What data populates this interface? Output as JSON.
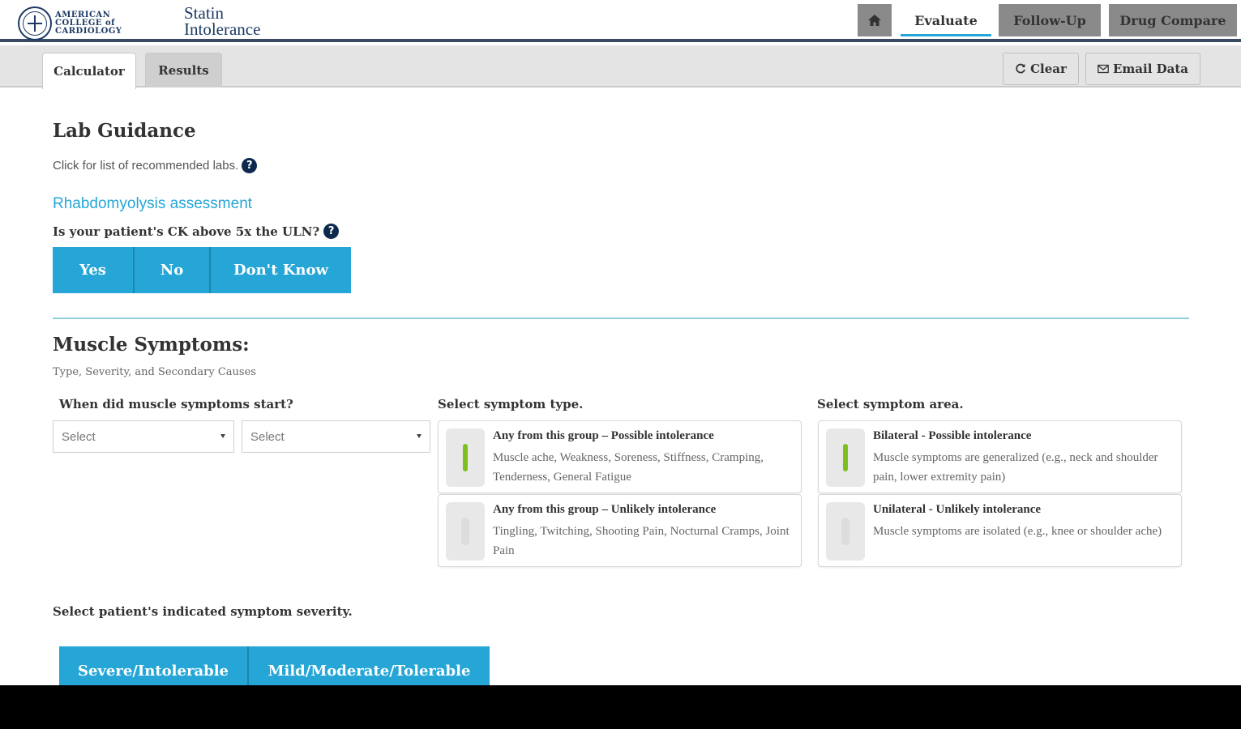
{
  "header": {
    "logo_text": [
      "AMERICAN",
      "COLLEGE of",
      "CARDIOLOGY"
    ],
    "app_title_line1": "Statin",
    "app_title_line2": "Intolerance",
    "nav": {
      "home_icon": "home-icon",
      "evaluate": "Evaluate",
      "follow_up": "Follow-Up",
      "drug_compare": "Drug Compare"
    }
  },
  "tabs": {
    "calculator": "Calculator",
    "results": "Results",
    "clear": "Clear",
    "clear_icon": "refresh-icon",
    "email": "Email Data",
    "email_icon": "envelope-icon"
  },
  "lab": {
    "title": "Lab Guidance",
    "subtitle": "Click for list of recommended labs.",
    "help_icon": "question-circle-icon"
  },
  "rhabdo": {
    "title": "Rhabdomyolysis assessment",
    "question": "Is your patient's CK above 5x the ULN?",
    "options": {
      "yes": "Yes",
      "no": "No",
      "dont_know": "Don't Know"
    }
  },
  "muscle": {
    "title": "Muscle Symptoms:",
    "subtitle": "Type, Severity, and Secondary Causes",
    "start_label": "When did muscle symptoms start?",
    "select1": "Select",
    "select2": "Select",
    "type_label": "Select symptom type.",
    "area_label": "Select symptom area.",
    "type_options": [
      {
        "title": "Any from this group – Possible intolerance",
        "desc": "Muscle ache, Weakness, Soreness, Stiffness, Cramping, Tenderness, General Fatigue",
        "selected": true
      },
      {
        "title": "Any from this group – Unlikely intolerance",
        "desc": "Tingling, Twitching, Shooting Pain, Nocturnal Cramps, Joint Pain",
        "selected": false
      }
    ],
    "area_options": [
      {
        "title": "Bilateral - Possible intolerance",
        "desc": "Muscle symptoms are generalized (e.g., neck and shoulder pain, lower extremity pain)",
        "selected": true
      },
      {
        "title": "Unilateral - Unlikely intolerance",
        "desc": "Muscle symptoms are isolated (e.g., knee or shoulder ache)",
        "selected": false
      }
    ],
    "severity_label": "Select patient's indicated symptom severity.",
    "severity": {
      "severe": "Severe/Intolerable",
      "mild": "Mild/Moderate/Tolerable"
    }
  },
  "colors": {
    "accent": "#25a6d6",
    "header_rule": "#3a4a63",
    "toggle_on": "#7cc01e",
    "nav_gray": "#8a8a8a"
  }
}
